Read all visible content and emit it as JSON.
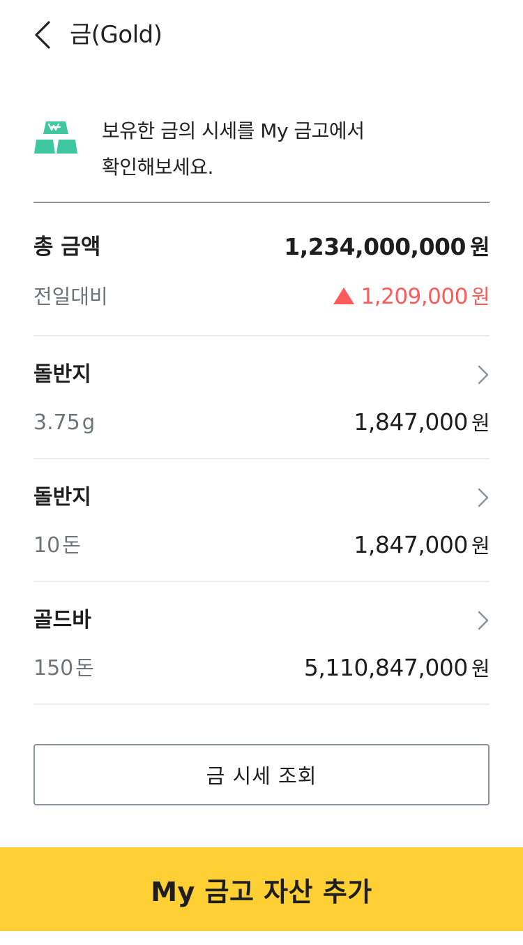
{
  "header": {
    "title": "금(Gold)",
    "back_icon": "chevron-left-icon"
  },
  "intro": {
    "icon": "gold-bars-icon",
    "text": "보유한 금의 시세를 My 금고에서\n확인해보세요."
  },
  "summary": {
    "total_label": "총 금액",
    "total_amount": "1,234,000,000",
    "total_unit": "원",
    "change_label": "전일대비",
    "change_direction": "up",
    "change_amount": "1,209,000",
    "change_unit": "원"
  },
  "items": [
    {
      "name": "돌반지",
      "qty": "3.75",
      "qty_unit": "g",
      "price": "1,847,000",
      "price_unit": "원"
    },
    {
      "name": "돌반지",
      "qty": "10",
      "qty_unit": "돈",
      "price": "1,847,000",
      "price_unit": "원"
    },
    {
      "name": "골드바",
      "qty": "150",
      "qty_unit": "돈",
      "price": "5,110,847,000",
      "price_unit": "원"
    }
  ],
  "buttons": {
    "price_lookup": "금 시세 조회",
    "add_asset": "My 금고 자산 추가"
  },
  "colors": {
    "accent_yellow": "#fed034",
    "gold_icon": "#3ec7a0",
    "increase_red": "#ff5a5a",
    "muted_text": "#6f7479",
    "divider": "#8d949c"
  }
}
